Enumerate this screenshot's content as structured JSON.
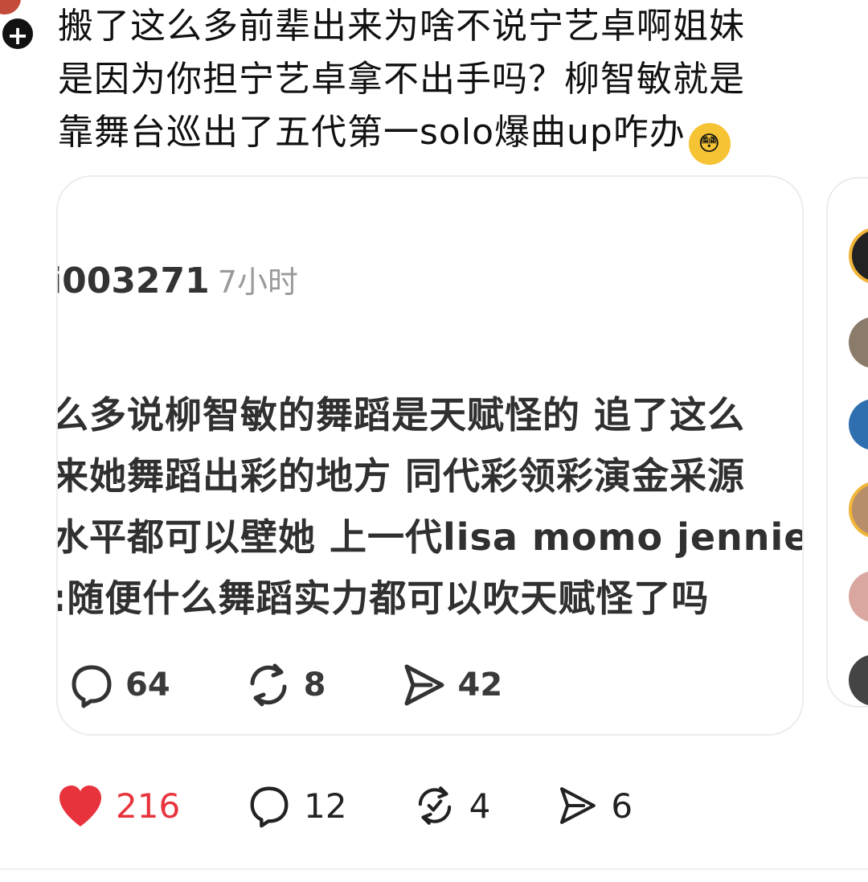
{
  "post": {
    "lines": [
      "搬了这么多前辈出来为啥不说宁艺卓啊姐妹",
      "是因为你担宁艺卓拿不出手吗？柳智敏就是",
      "靠舞台巡出了五代第一solo爆曲up咋办"
    ],
    "emoji": "😳"
  },
  "quoted": {
    "username": "i003271",
    "time": "7小时",
    "lines": [
      "么多说柳智敏的舞蹈是天赋怪的 追了这么",
      "来她舞蹈出彩的地方 同代彩领彩演金采源",
      "水平都可以壁她 上一代lisa momo jennie",
      ":随便什么舞蹈实力都可以吹天赋怪了吗"
    ],
    "stats": {
      "comments": "64",
      "reposts": "8",
      "shares": "42"
    }
  },
  "actions": {
    "likes": "216",
    "comments": "12",
    "reposts": "4",
    "shares": "6"
  },
  "colors": {
    "like": "#e8333d",
    "text": "#111111"
  },
  "icons": [
    "plus-icon",
    "comment-icon",
    "repost-icon",
    "share-icon",
    "heart-icon"
  ]
}
